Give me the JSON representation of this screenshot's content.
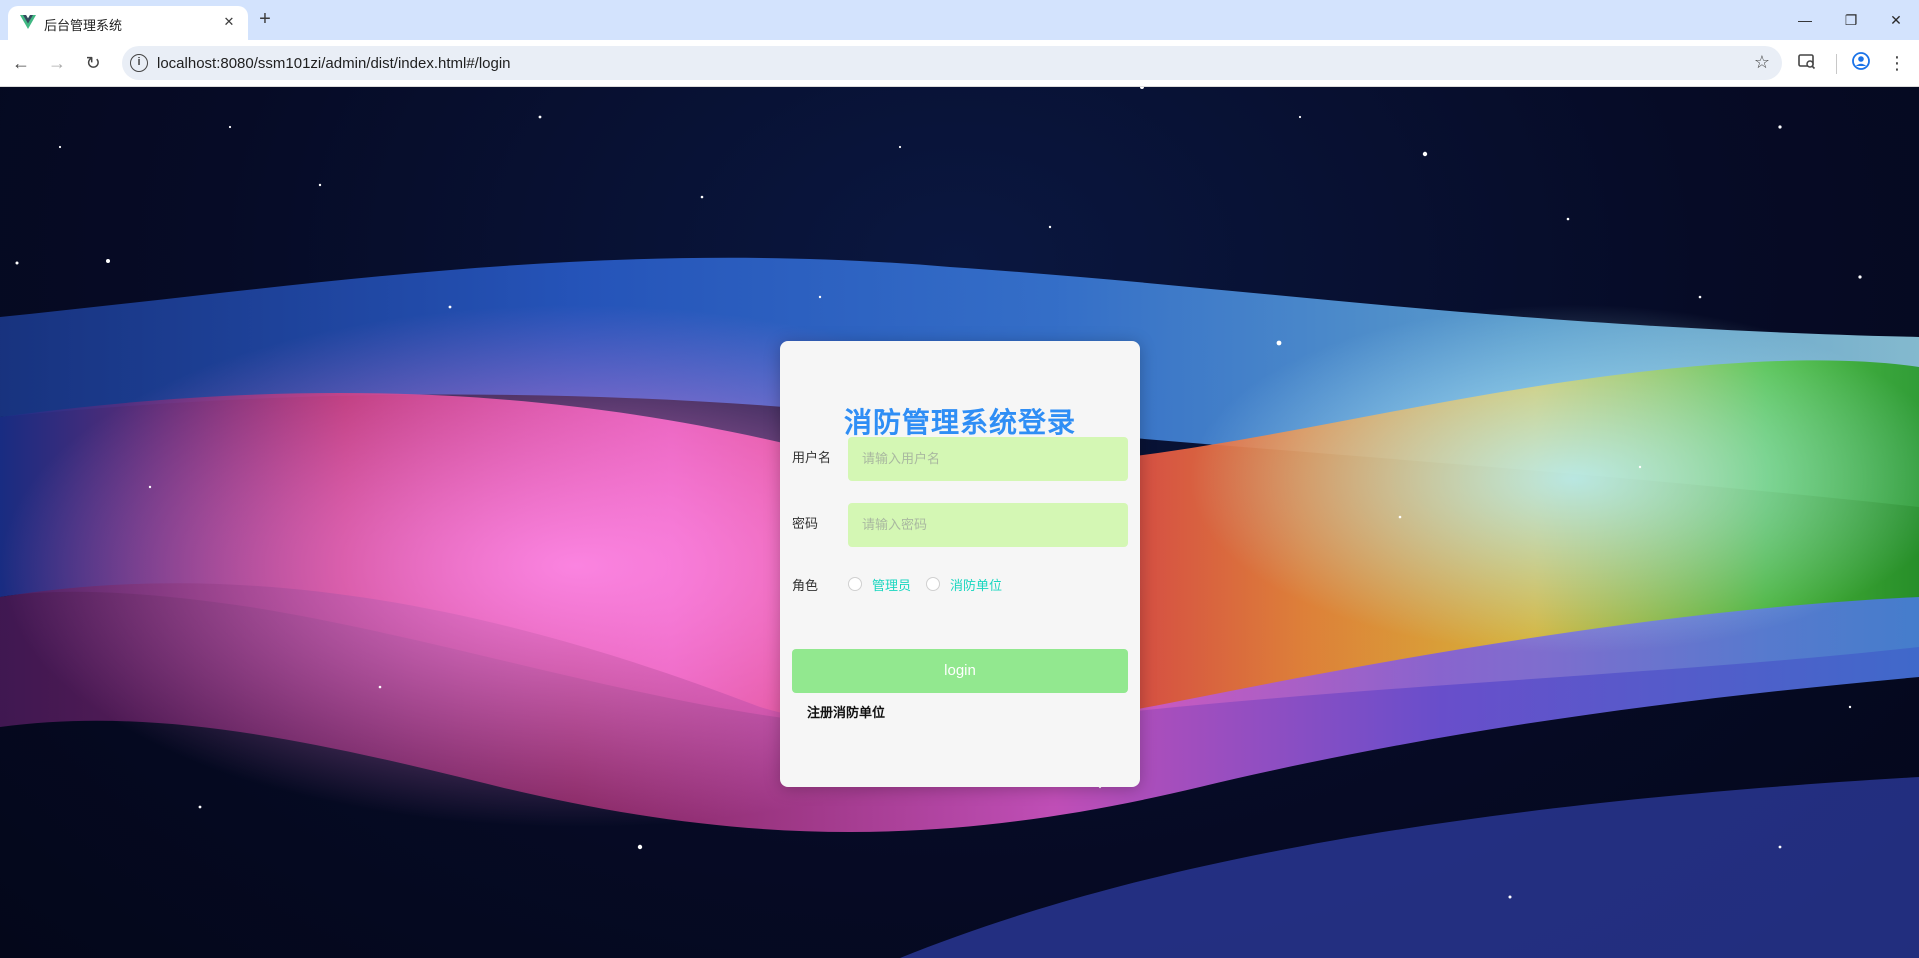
{
  "browser": {
    "tab_title": "后台管理系统",
    "tab_close": "✕",
    "new_tab": "+",
    "url": "localhost:8080/ssm101zi/admin/dist/index.html#/login",
    "window_controls": {
      "minimize": "—",
      "restore": "❐",
      "close": "✕"
    }
  },
  "login": {
    "title": "消防管理系统登录",
    "username_label": "用户名",
    "username_placeholder": "请输入用户名",
    "password_label": "密码",
    "password_placeholder": "请输入密码",
    "role_label": "角色",
    "roles": [
      "管理员",
      "消防单位"
    ],
    "login_button": "login",
    "register_link": "注册消防单位"
  },
  "colors": {
    "title": "#2f8ef5",
    "input_bg": "#d4f7b4",
    "button_bg": "#92e88f",
    "role_text": "#1ad6c0",
    "card_bg": "#f6f6f6"
  }
}
